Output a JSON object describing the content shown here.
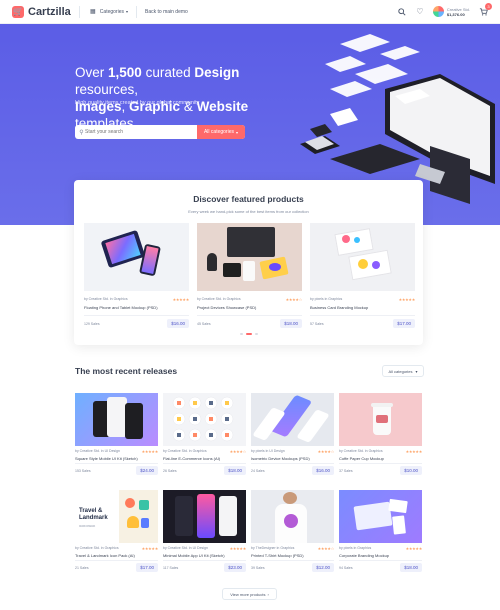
{
  "header": {
    "logo": "Cartzilla",
    "categories": "Categories",
    "back_link": "Back to main demo",
    "account_label": "Creative Std.",
    "account_balance": "$1,376.00"
  },
  "hero": {
    "line1_prefix": "Over ",
    "count": "1,500",
    "line1_mid": " curated ",
    "design": "Design",
    "line1_suffix": " resources,",
    "images": "Images",
    "comma": ", ",
    "graphic": "Graphic",
    "amp": " & ",
    "website": "Website",
    "line2_suffix": " templates",
    "subtitle": "High quality items created by our global community",
    "search_placeholder": "Start your search",
    "search_category": "All categories"
  },
  "featured": {
    "title": "Discover featured products",
    "subtitle": "Every week we hand-pick some of the best items from our collection",
    "items": [
      {
        "author": "by Creative Std. in Graphics",
        "title": "Floating Phone and Tablet Mockup (PSD)",
        "sales": "129 Sales",
        "price": "$16.00"
      },
      {
        "author": "by Creative Std. in Graphics",
        "title": "Project Devices Showcase (PSD)",
        "sales": "45 Sales",
        "price": "$18.00"
      },
      {
        "author": "by pixels in Graphics",
        "title": "Business Card Branding Mockup",
        "sales": "57 Sales",
        "price": "$17.00"
      }
    ]
  },
  "recent": {
    "title": "The most recent releases",
    "filter": "All categories",
    "items": [
      {
        "author": "by Creative Std. in UI Design",
        "title": "Square Style Mobile UI Kit (Sketch)",
        "sales": "153 Sales",
        "price": "$24.00"
      },
      {
        "author": "by Creative Std. in Graphics",
        "title": "Flat-line E-Commerce Icons (AI)",
        "sales": "26 Sales",
        "price": "$18.00"
      },
      {
        "author": "by pixels in UI Design",
        "title": "Isometric Device Mockups (PSD)",
        "sales": "24 Sales",
        "price": "$16.00"
      },
      {
        "author": "by Creative Std. in Graphics",
        "title": "Coffe Paper Cup Mockup",
        "sales": "37 Sales",
        "price": "$10.00"
      },
      {
        "author": "by Creative Std. in Graphics",
        "title": "Travel & Landmark Icon Pack (AI)",
        "sales": "21 Sales",
        "price": "$17.00"
      },
      {
        "author": "by Creative Std. in UI Design",
        "title": "Minimal Mobile App UI Kit (Sketch)",
        "sales": "117 Sales",
        "price": "$23.00"
      },
      {
        "author": "by TheDesigner in Graphics",
        "title": "Printed T-Shirt Mockup (PSD)",
        "sales": "39 Sales",
        "price": "$12.00"
      },
      {
        "author": "by pixels in Graphics",
        "title": "Corporate Branding Mockup",
        "sales": "94 Sales",
        "price": "$18.00"
      }
    ]
  },
  "view_more": "View more products"
}
